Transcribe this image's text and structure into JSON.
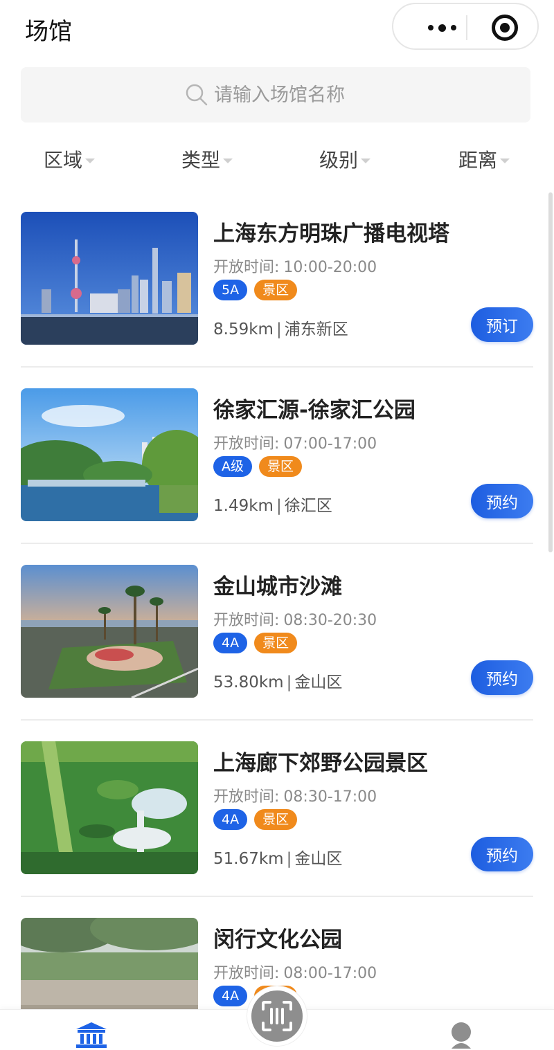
{
  "header": {
    "title": "场馆"
  },
  "search": {
    "placeholder": "请输入场馆名称"
  },
  "filters": [
    {
      "label": "区域"
    },
    {
      "label": "类型"
    },
    {
      "label": "级别"
    },
    {
      "label": "距离"
    }
  ],
  "hours_label": "开放时间:",
  "venues": [
    {
      "name": "上海东方明珠广播电视塔",
      "hours": "10:00-20:00",
      "level": "5A",
      "category": "景区",
      "distance": "8.59km",
      "district": "浦东新区",
      "action": "预订"
    },
    {
      "name": "徐家汇源-徐家汇公园",
      "hours": "07:00-17:00",
      "level": "A级",
      "category": "景区",
      "distance": "1.49km",
      "district": "徐汇区",
      "action": "预约"
    },
    {
      "name": "金山城市沙滩",
      "hours": "08:30-20:30",
      "level": "4A",
      "category": "景区",
      "distance": "53.80km",
      "district": "金山区",
      "action": "预约"
    },
    {
      "name": "上海廊下郊野公园景区",
      "hours": "08:30-17:00",
      "level": "4A",
      "category": "景区",
      "distance": "51.67km",
      "district": "金山区",
      "action": "预约"
    },
    {
      "name": "闵行文化公园",
      "hours": "08:00-17:00",
      "level": "4A",
      "category": "景区"
    }
  ],
  "colors": {
    "accent": "#1e63e6",
    "tag_orange": "#f08a1c",
    "tab_active": "#1e63e6",
    "tab_inactive": "#8e8e8e"
  },
  "tabbar": [
    {
      "icon": "venue-icon",
      "active": true
    },
    {
      "icon": "scan-icon",
      "active": false
    },
    {
      "icon": "profile-icon",
      "active": false
    }
  ]
}
